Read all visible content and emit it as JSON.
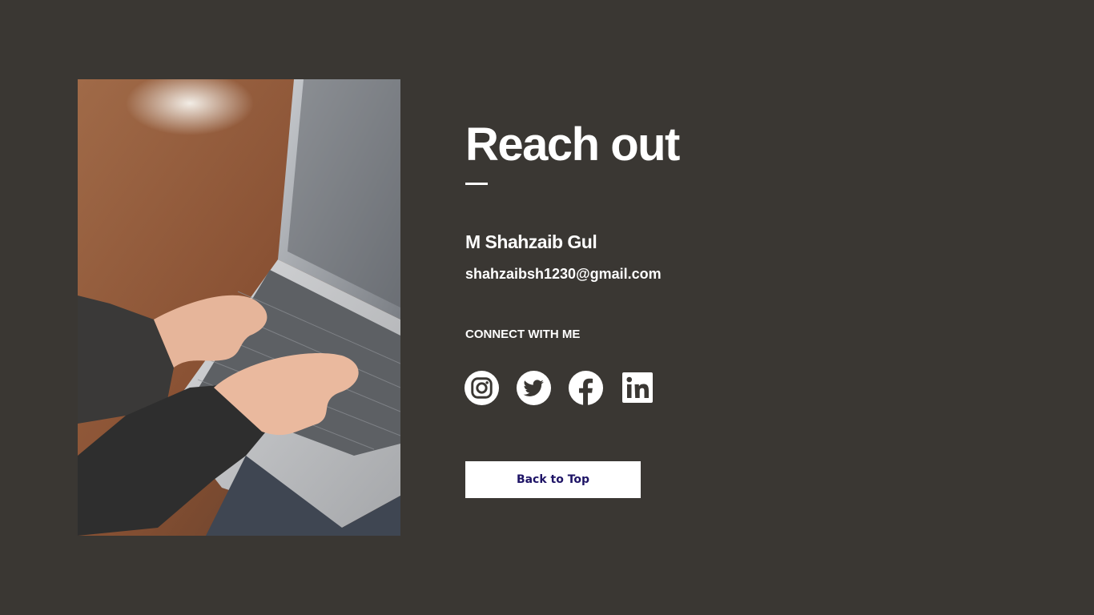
{
  "contact": {
    "heading": "Reach out",
    "name": "M Shahzaib Gul",
    "email": "shahzaibsh1230@gmail.com",
    "connect_label": "CONNECT WITH ME",
    "socials": [
      {
        "icon": "instagram-icon"
      },
      {
        "icon": "twitter-icon"
      },
      {
        "icon": "facebook-icon"
      },
      {
        "icon": "linkedin-icon"
      }
    ],
    "back_to_top_label": "Back to Top"
  },
  "colors": {
    "background": "#3a3733",
    "text": "#ffffff",
    "button_background": "#ffffff",
    "button_text": "#1e1466"
  }
}
